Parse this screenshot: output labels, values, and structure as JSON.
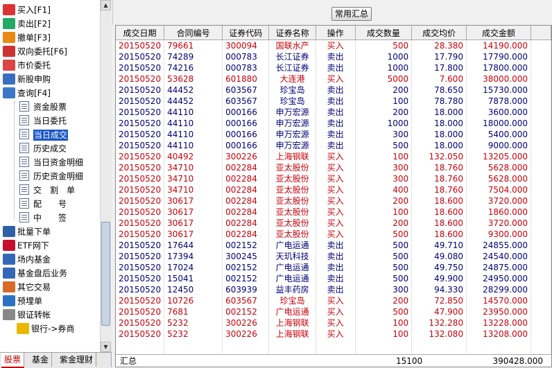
{
  "sidebar": {
    "items": [
      {
        "label": "买入[F1]",
        "icon": "buy-icon"
      },
      {
        "label": "卖出[F2]",
        "icon": "sell-icon"
      },
      {
        "label": "撤单[F3]",
        "icon": "cancel-order-icon"
      },
      {
        "label": "双向委托[F6]",
        "icon": "two-way-order-icon"
      },
      {
        "label": "市价委托",
        "icon": "market-order-icon"
      },
      {
        "label": "新股申购",
        "icon": "ipo-subscribe-icon"
      },
      {
        "label": "查询[F4]",
        "icon": "query-icon"
      },
      {
        "label": "资金股票",
        "icon": "document-icon"
      },
      {
        "label": "当日委托",
        "icon": "document-icon"
      },
      {
        "label": "当日成交",
        "icon": "document-icon",
        "selected": true
      },
      {
        "label": "历史成交",
        "icon": "document-icon"
      },
      {
        "label": "当日资金明细",
        "icon": "document-icon"
      },
      {
        "label": "历史资金明细",
        "icon": "document-icon"
      },
      {
        "label": "交　割　单",
        "icon": "document-icon"
      },
      {
        "label": "配　　号",
        "icon": "document-icon"
      },
      {
        "label": "中　　签",
        "icon": "document-icon"
      },
      {
        "label": "批量下单",
        "icon": "batch-order-icon"
      },
      {
        "label": "ETF网下",
        "icon": "etf-icon"
      },
      {
        "label": "场内基金",
        "icon": "fund-icon"
      },
      {
        "label": "基金盘后业务",
        "icon": "fund-after-hours-icon"
      },
      {
        "label": "其它交易",
        "icon": "other-trade-icon"
      },
      {
        "label": "预埋单",
        "icon": "preset-order-icon"
      },
      {
        "label": "银证转帐",
        "icon": "bank-transfer-icon"
      },
      {
        "label": "银行->券商",
        "icon": "bank-to-broker-icon"
      }
    ],
    "tabs": [
      "股票",
      "基金",
      "紫金理财"
    ]
  },
  "toolbar": {
    "summary_button": "常用汇总"
  },
  "table": {
    "columns": [
      "成交日期",
      "合同编号",
      "证券代码",
      "证券名称",
      "操作",
      "成交数量",
      "成交均价",
      "成交金额"
    ],
    "rows": [
      {
        "date": "20150520",
        "contract": "79661",
        "code": "300094",
        "name": "国联水产",
        "op": "买入",
        "qty": "500",
        "price": "28.380",
        "amount": "14190.000"
      },
      {
        "date": "20150520",
        "contract": "74289",
        "code": "000783",
        "name": "长江证券",
        "op": "卖出",
        "qty": "1000",
        "price": "17.790",
        "amount": "17790.000"
      },
      {
        "date": "20150520",
        "contract": "74216",
        "code": "000783",
        "name": "长江证券",
        "op": "卖出",
        "qty": "1000",
        "price": "17.800",
        "amount": "17800.000"
      },
      {
        "date": "20150520",
        "contract": "53628",
        "code": "601880",
        "name": "大连港",
        "op": "买入",
        "qty": "5000",
        "price": "7.600",
        "amount": "38000.000"
      },
      {
        "date": "20150520",
        "contract": "44452",
        "code": "603567",
        "name": "珍宝岛",
        "op": "卖出",
        "qty": "200",
        "price": "78.650",
        "amount": "15730.000"
      },
      {
        "date": "20150520",
        "contract": "44452",
        "code": "603567",
        "name": "珍宝岛",
        "op": "卖出",
        "qty": "100",
        "price": "78.780",
        "amount": "7878.000"
      },
      {
        "date": "20150520",
        "contract": "44110",
        "code": "000166",
        "name": "申万宏源",
        "op": "卖出",
        "qty": "200",
        "price": "18.000",
        "amount": "3600.000"
      },
      {
        "date": "20150520",
        "contract": "44110",
        "code": "000166",
        "name": "申万宏源",
        "op": "卖出",
        "qty": "1000",
        "price": "18.000",
        "amount": "18000.000"
      },
      {
        "date": "20150520",
        "contract": "44110",
        "code": "000166",
        "name": "申万宏源",
        "op": "卖出",
        "qty": "300",
        "price": "18.000",
        "amount": "5400.000"
      },
      {
        "date": "20150520",
        "contract": "44110",
        "code": "000166",
        "name": "申万宏源",
        "op": "卖出",
        "qty": "500",
        "price": "18.000",
        "amount": "9000.000"
      },
      {
        "date": "20150520",
        "contract": "40492",
        "code": "300226",
        "name": "上海钢联",
        "op": "买入",
        "qty": "100",
        "price": "132.050",
        "amount": "13205.000"
      },
      {
        "date": "20150520",
        "contract": "34710",
        "code": "002284",
        "name": "亚太股份",
        "op": "买入",
        "qty": "300",
        "price": "18.760",
        "amount": "5628.000"
      },
      {
        "date": "20150520",
        "contract": "34710",
        "code": "002284",
        "name": "亚太股份",
        "op": "买入",
        "qty": "300",
        "price": "18.760",
        "amount": "5628.000"
      },
      {
        "date": "20150520",
        "contract": "34710",
        "code": "002284",
        "name": "亚太股份",
        "op": "买入",
        "qty": "400",
        "price": "18.760",
        "amount": "7504.000"
      },
      {
        "date": "20150520",
        "contract": "30617",
        "code": "002284",
        "name": "亚太股份",
        "op": "买入",
        "qty": "200",
        "price": "18.600",
        "amount": "3720.000"
      },
      {
        "date": "20150520",
        "contract": "30617",
        "code": "002284",
        "name": "亚太股份",
        "op": "买入",
        "qty": "100",
        "price": "18.600",
        "amount": "1860.000"
      },
      {
        "date": "20150520",
        "contract": "30617",
        "code": "002284",
        "name": "亚太股份",
        "op": "买入",
        "qty": "200",
        "price": "18.600",
        "amount": "3720.000"
      },
      {
        "date": "20150520",
        "contract": "30617",
        "code": "002284",
        "name": "亚太股份",
        "op": "买入",
        "qty": "500",
        "price": "18.600",
        "amount": "9300.000"
      },
      {
        "date": "20150520",
        "contract": "17644",
        "code": "002152",
        "name": "广电运通",
        "op": "卖出",
        "qty": "500",
        "price": "49.710",
        "amount": "24855.000"
      },
      {
        "date": "20150520",
        "contract": "17394",
        "code": "300245",
        "name": "天玑科技",
        "op": "卖出",
        "qty": "500",
        "price": "49.080",
        "amount": "24540.000"
      },
      {
        "date": "20150520",
        "contract": "17024",
        "code": "002152",
        "name": "广电运通",
        "op": "卖出",
        "qty": "500",
        "price": "49.750",
        "amount": "24875.000"
      },
      {
        "date": "20150520",
        "contract": "15041",
        "code": "002152",
        "name": "广电运通",
        "op": "卖出",
        "qty": "500",
        "price": "49.900",
        "amount": "24950.000"
      },
      {
        "date": "20150520",
        "contract": "12450",
        "code": "603939",
        "name": "益丰药房",
        "op": "卖出",
        "qty": "300",
        "price": "94.330",
        "amount": "28299.000"
      },
      {
        "date": "20150520",
        "contract": "10726",
        "code": "603567",
        "name": "珍宝岛",
        "op": "买入",
        "qty": "200",
        "price": "72.850",
        "amount": "14570.000"
      },
      {
        "date": "20150520",
        "contract": "7681",
        "code": "002152",
        "name": "广电运通",
        "op": "买入",
        "qty": "500",
        "price": "47.900",
        "amount": "23950.000"
      },
      {
        "date": "20150520",
        "contract": "5232",
        "code": "300226",
        "name": "上海钢联",
        "op": "买入",
        "qty": "100",
        "price": "132.280",
        "amount": "13228.000"
      },
      {
        "date": "20150520",
        "contract": "5232",
        "code": "300226",
        "name": "上海钢联",
        "op": "买入",
        "qty": "100",
        "price": "132.080",
        "amount": "13208.000"
      }
    ],
    "totals": {
      "label": "汇总",
      "qty": "15100",
      "amount": "390428.000"
    }
  },
  "colors": {
    "buy": "#c8000a",
    "sell": "#00007a",
    "selection": "#1a57c8",
    "tab_active": "#c00000"
  }
}
